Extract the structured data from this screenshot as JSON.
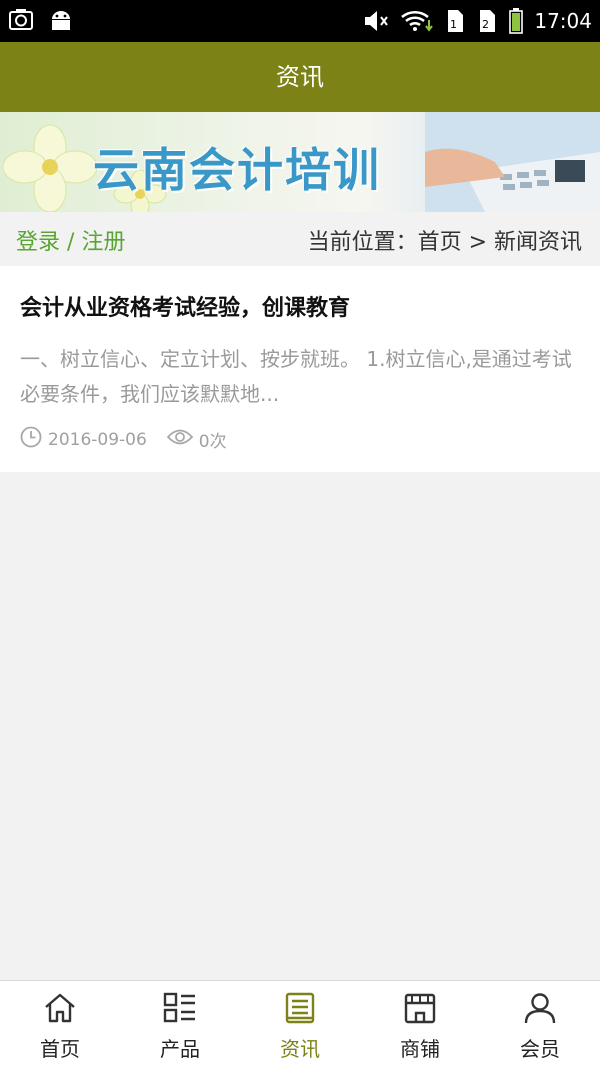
{
  "status_bar": {
    "time": "17:04"
  },
  "header": {
    "title": "资讯"
  },
  "banner": {
    "title": "云南会计培训"
  },
  "breadcrumb": {
    "login": "登录",
    "separator": "/",
    "register": "注册",
    "location": "当前位置：首页 > 新闻资讯"
  },
  "article": {
    "title": "会计从业资格考试经验，创课教育",
    "summary": "一、树立信心、定立计划、按步就班。 1.树立信心,是通过考试必要条件，我们应该默默地...",
    "date": "2016-09-06",
    "views": "0次"
  },
  "nav": {
    "items": [
      {
        "label": "首页",
        "icon": "home-icon"
      },
      {
        "label": "产品",
        "icon": "grid-list-icon"
      },
      {
        "label": "资讯",
        "icon": "document-icon",
        "active": true
      },
      {
        "label": "商铺",
        "icon": "store-icon"
      },
      {
        "label": "会员",
        "icon": "user-icon"
      }
    ]
  },
  "colors": {
    "header": "#7c8215",
    "accent_green": "#5aa532",
    "active_nav": "#7c8215",
    "background": "#f2f2f2"
  }
}
